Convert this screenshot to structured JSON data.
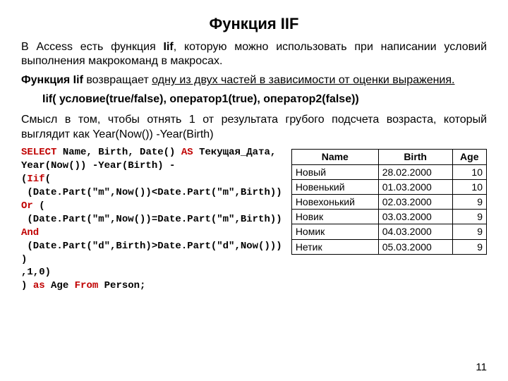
{
  "title": "Функция IIF",
  "para1_pre": "В Access есть функция ",
  "para1_iif": "Iif",
  "para1_post": ", которую можно использовать при написании условий выполнения макрокоманд в макросах.",
  "para2_pre": "Функция Iif",
  "para2_mid": " возвращает ",
  "para2_u": "одну из двух частей в зависимости от оценки выражения.",
  "syntax": "Iif( условие(true/false), оператор1(true), оператор2(false))",
  "para3": "Смысл в том, чтобы отнять 1 от результата грубого подсчета возраста, который выглядит как Year(Now()) -Year(Birth)",
  "code": {
    "l1a": "SELECT",
    "l1b": " Name, Birth, Date() ",
    "l1c": "AS",
    "l1d": " Текущая_Дата,",
    "l2": "Year(Now()) -Year(Birth) -",
    "l3a": "(",
    "l3b": "Iif",
    "l3c": "(",
    "l4": " (Date.Part(\"m\",Now())<Date.Part(\"m\",Birth))",
    "l5a": "Or",
    "l5b": " (",
    "l6": " (Date.Part(\"m\",Now())=Date.Part(\"m\",Birth))",
    "l7": "And",
    "l8": " (Date.Part(\"d\",Birth)>Date.Part(\"d\",Now()))",
    "l9": ")",
    "l10": ",1,0)",
    "l11a": ") ",
    "l11b": "as",
    "l11c": " Age ",
    "l11d": "From",
    "l11e": " Person;"
  },
  "table": {
    "headers": [
      "Name",
      "Birth",
      "Age"
    ],
    "rows": [
      [
        "Новый",
        "28.02.2000",
        "10"
      ],
      [
        "Новенький",
        "01.03.2000",
        "10"
      ],
      [
        "Новехонький",
        "02.03.2000",
        "9"
      ],
      [
        "Новик",
        "03.03.2000",
        "9"
      ],
      [
        "Номик",
        "04.03.2000",
        "9"
      ],
      [
        "Нетик",
        "05.03.2000",
        "9"
      ]
    ]
  },
  "pagenum": "11"
}
